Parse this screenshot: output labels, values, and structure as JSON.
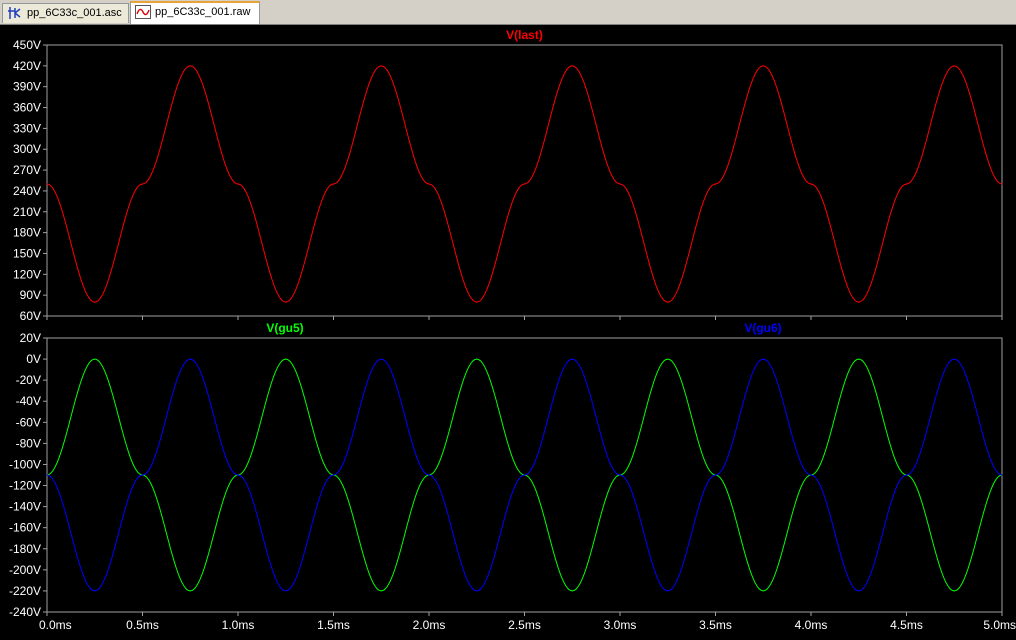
{
  "tabs": [
    {
      "label": "pp_6C33c_001.asc",
      "icon": "schematic-icon",
      "active": false
    },
    {
      "label": "pp_6C33c_001.raw",
      "icon": "waveform-icon",
      "active": true
    }
  ],
  "colors": {
    "background": "#000000",
    "grid": "#a0a0a0",
    "axis_text": "#ffffff",
    "v_last": "#ff0000",
    "v_gu5": "#00ff00",
    "v_gu6": "#0000ff"
  },
  "chart_data": [
    {
      "type": "line",
      "title": "",
      "xlabel": "",
      "ylabel": "",
      "xlim": [
        0.0,
        5.0
      ],
      "ylim": [
        60,
        450
      ],
      "x_ticks": [
        "0.0ms",
        "0.5ms",
        "1.0ms",
        "1.5ms",
        "2.0ms",
        "2.5ms",
        "3.0ms",
        "3.5ms",
        "4.0ms",
        "4.5ms",
        "5.0ms"
      ],
      "y_ticks": [
        "450V",
        "420V",
        "390V",
        "360V",
        "330V",
        "300V",
        "270V",
        "240V",
        "210V",
        "180V",
        "150V",
        "120V",
        "90V",
        "60V"
      ],
      "series": [
        {
          "name": "V(last)",
          "color": "#ff0000",
          "x": [
            0.0,
            0.25,
            0.5,
            0.75,
            1.0,
            1.25,
            1.5,
            1.75,
            2.0,
            2.25,
            2.5,
            2.75,
            3.0,
            3.25,
            3.5,
            3.75,
            4.0,
            4.25,
            4.5,
            4.75,
            5.0
          ],
          "values": [
            250,
            80,
            250,
            420,
            250,
            80,
            250,
            420,
            250,
            80,
            250,
            420,
            250,
            80,
            250,
            420,
            250,
            80,
            250,
            420,
            250
          ]
        }
      ]
    },
    {
      "type": "line",
      "title": "",
      "xlabel": "",
      "ylabel": "",
      "xlim": [
        0.0,
        5.0
      ],
      "ylim": [
        -240,
        20
      ],
      "x_ticks": [
        "0.0ms",
        "0.5ms",
        "1.0ms",
        "1.5ms",
        "2.0ms",
        "2.5ms",
        "3.0ms",
        "3.5ms",
        "4.0ms",
        "4.5ms",
        "5.0ms"
      ],
      "y_ticks": [
        "20V",
        "0V",
        "-20V",
        "-40V",
        "-60V",
        "-80V",
        "-100V",
        "-120V",
        "-140V",
        "-160V",
        "-180V",
        "-200V",
        "-220V",
        "-240V"
      ],
      "series": [
        {
          "name": "V(gu5)",
          "color": "#00ff00",
          "x": [
            0.0,
            0.25,
            0.5,
            0.75,
            1.0,
            1.25,
            1.5,
            1.75,
            2.0,
            2.25,
            2.5,
            2.75,
            3.0,
            3.25,
            3.5,
            3.75,
            4.0,
            4.25,
            4.5,
            4.75,
            5.0
          ],
          "values": [
            -110,
            0,
            -110,
            -220,
            -110,
            0,
            -110,
            -220,
            -110,
            0,
            -110,
            -220,
            -110,
            0,
            -110,
            -220,
            -110,
            0,
            -110,
            -220,
            -110
          ]
        },
        {
          "name": "V(gu6)",
          "color": "#0000ff",
          "x": [
            0.0,
            0.25,
            0.5,
            0.75,
            1.0,
            1.25,
            1.5,
            1.75,
            2.0,
            2.25,
            2.5,
            2.75,
            3.0,
            3.25,
            3.5,
            3.75,
            4.0,
            4.25,
            4.5,
            4.75,
            5.0
          ],
          "values": [
            -110,
            -220,
            -110,
            0,
            -110,
            -220,
            -110,
            0,
            -110,
            -220,
            -110,
            0,
            -110,
            -220,
            -110,
            0,
            -110,
            -220,
            -110,
            0,
            -110
          ]
        }
      ]
    }
  ]
}
